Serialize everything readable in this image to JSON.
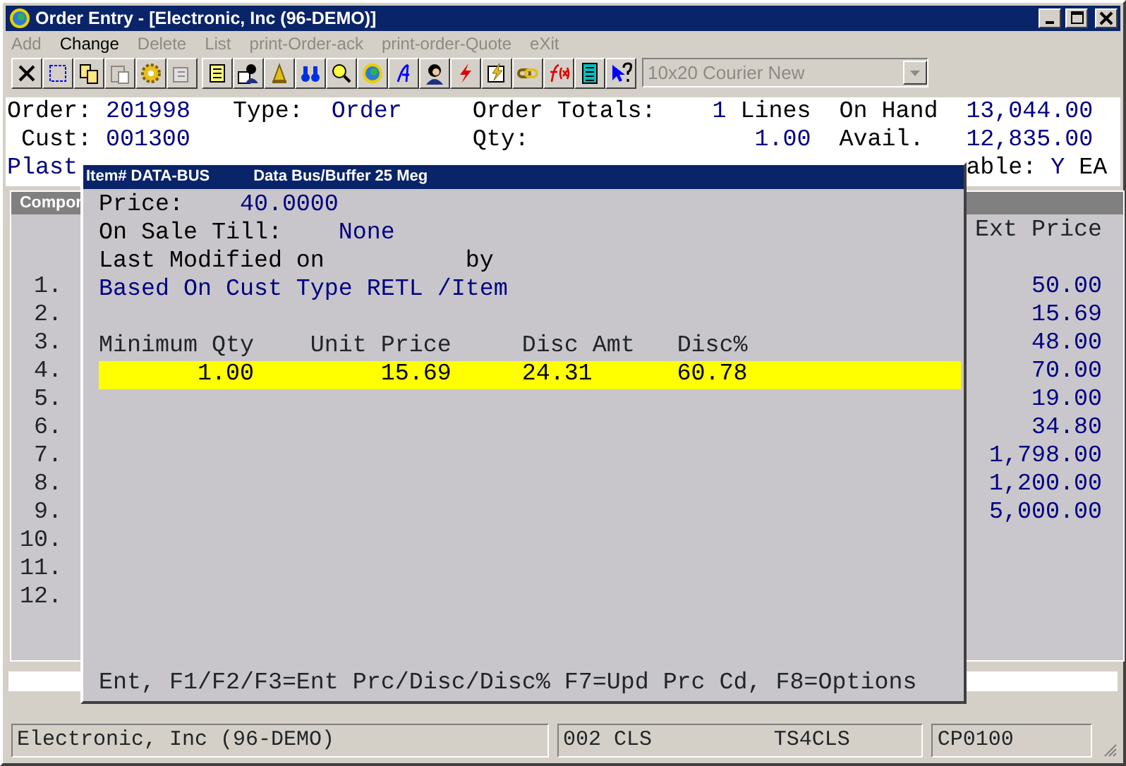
{
  "window": {
    "title": "Order Entry - [Electronic, Inc (96-DEMO)]"
  },
  "menu": [
    {
      "label": "Add",
      "disabled": true
    },
    {
      "label": "Change",
      "disabled": false
    },
    {
      "label": "Delete",
      "disabled": true
    },
    {
      "label": "List",
      "disabled": true
    },
    {
      "label": "print-Order-ack",
      "disabled": true
    },
    {
      "label": "print-order-Quote",
      "disabled": true
    },
    {
      "label": "eXit",
      "disabled": true
    }
  ],
  "font_selector": {
    "value": "10x20 Courier New",
    "disabled": true
  },
  "header": {
    "rows": [
      {
        "fields": [
          {
            "label": "Order:",
            "value": "201998"
          },
          {
            "label": "Type:",
            "value": "Order"
          },
          {
            "label": "Order Totals:",
            "value": "1",
            "unit": "Lines"
          },
          {
            "label": "On Hand",
            "value": "13,044.00"
          }
        ]
      },
      {
        "fields": [
          {
            "label": "Cust:",
            "value": "001300"
          },
          {
            "label": "Qty:",
            "value": "1.00"
          },
          {
            "label": "Avail.",
            "value": "12,835.00"
          }
        ]
      },
      {
        "fields": [
          {
            "value": "Plast"
          },
          {
            "label": "able:",
            "value": "Y",
            "unit": "EA"
          }
        ]
      }
    ]
  },
  "grid": {
    "header": "Compor",
    "columns": [
      "Ext Price"
    ],
    "rows": [
      {
        "number": "1.",
        "ext_price": "50.00"
      },
      {
        "number": "2.",
        "ext_price": "15.69"
      },
      {
        "number": "3.",
        "ext_price": "48.00"
      },
      {
        "number": "4.",
        "ext_price": "70.00"
      },
      {
        "number": "5.",
        "ext_price": "19.00"
      },
      {
        "number": "6.",
        "ext_price": "34.80"
      },
      {
        "number": "7.",
        "ext_price": "1,798.00"
      },
      {
        "number": "8.",
        "ext_price": "1,200.00"
      },
      {
        "number": "9.",
        "ext_price": "5,000.00"
      },
      {
        "number": "10."
      },
      {
        "number": "11."
      },
      {
        "number": "12."
      }
    ]
  },
  "popup": {
    "title": "Item# DATA-BUS",
    "description": "Data Bus/Buffer 25 Meg",
    "lines": [
      [
        {
          "text": "Price:",
          "kind": "label"
        },
        {
          "text": "40.0000",
          "kind": "value"
        }
      ],
      [
        {
          "text": "On Sale Till:",
          "kind": "label"
        },
        {
          "text": "None",
          "kind": "value"
        }
      ],
      [
        {
          "text": "Last Modified on",
          "kind": "label"
        },
        {
          "text": "by",
          "kind": "label"
        }
      ],
      [
        {
          "text": "Based On Cust Type RETL /Item",
          "kind": "value"
        }
      ]
    ],
    "table": {
      "columns": [
        "Minimum Qty",
        "Unit Price",
        "Disc Amt",
        "Disc%"
      ],
      "rows": [
        {
          "cells": [
            "1.00",
            "15.69",
            "24.31",
            "60.78"
          ],
          "selected": true
        }
      ]
    },
    "footer": "Ent, F1/F2/F3=Ent Prc/Disc/Disc% F7=Upd Prc Cd, F8=Options"
  },
  "status_bar": [
    {
      "texts": [
        "Electronic, Inc (96-DEMO)"
      ]
    },
    {
      "texts": [
        "002 CLS",
        "TS4CLS"
      ]
    },
    {
      "texts": [
        "CP0100"
      ]
    }
  ]
}
